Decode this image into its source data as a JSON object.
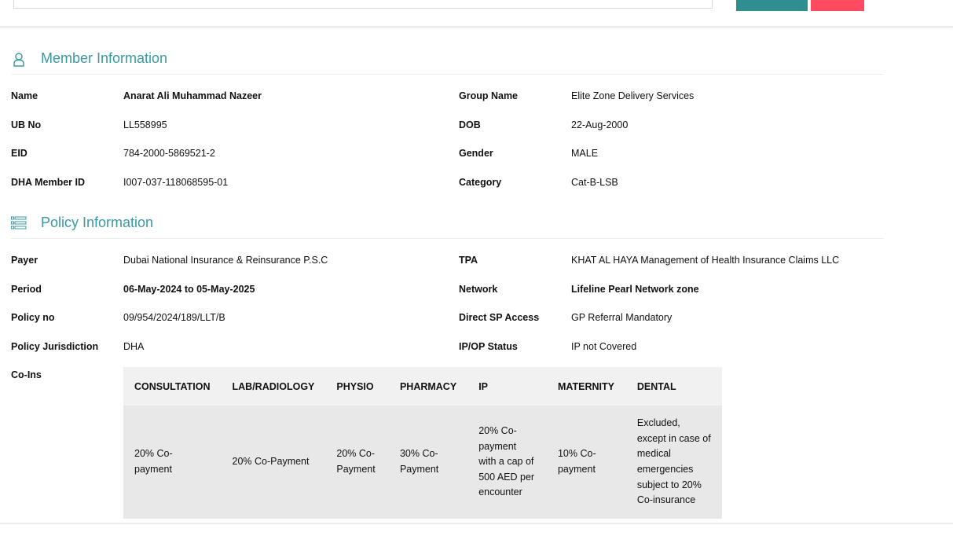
{
  "member": {
    "title": "Member Information",
    "left": [
      {
        "label": "Name",
        "value": "Anarat Ali Muhammad Nazeer",
        "bold": true
      },
      {
        "label": "UB No",
        "value": "LL558995"
      },
      {
        "label": "EID",
        "value": "784-2000-5869521-2"
      },
      {
        "label": "DHA Member ID",
        "value": "I007-037-118068595-01"
      }
    ],
    "right": [
      {
        "label": "Group Name",
        "value": "Elite Zone Delivery Services"
      },
      {
        "label": "DOB",
        "value": "22-Aug-2000"
      },
      {
        "label": "Gender",
        "value": "MALE"
      },
      {
        "label": "Category",
        "value": "Cat-B-LSB"
      }
    ]
  },
  "policy": {
    "title": "Policy Information",
    "left": [
      {
        "label": "Payer",
        "value": "Dubai National Insurance & Reinsurance P.S.C"
      },
      {
        "label": "Period",
        "value": "06-May-2024 to 05-May-2025",
        "bold": true
      },
      {
        "label": "Policy no",
        "value": "09/954/2024/189/LLT/B"
      },
      {
        "label": "Policy Jurisdiction",
        "value": "DHA"
      }
    ],
    "right": [
      {
        "label": "TPA",
        "value": "KHAT AL HAYA Management of Health Insurance Claims LLC"
      },
      {
        "label": "Network",
        "value": "Lifeline Pearl Network zone",
        "bold": true
      },
      {
        "label": "Direct SP Access",
        "value": "GP Referral Mandatory"
      },
      {
        "label": "IP/OP Status",
        "value": "IP not Covered"
      }
    ],
    "coins_label": "Co-Ins",
    "coins_headers": [
      "CONSULTATION",
      "LAB/RADIOLOGY",
      "PHYSIO",
      "PHARMACY",
      "IP",
      "MATERNITY",
      "DENTAL"
    ],
    "coins_values": [
      "20% Co-payment",
      "20% Co-Payment",
      "20% Co-Payment",
      "30% Co-Payment",
      "20% Co-payment with a cap of 500 AED per encounter",
      "10% Co-payment",
      "Excluded, except in case of medical emergencies subject to 20% Co-insurance"
    ]
  },
  "colors": {
    "accent": "#3a98a3",
    "teal_button": "#2f8e90",
    "red_button": "#ff4a60"
  }
}
